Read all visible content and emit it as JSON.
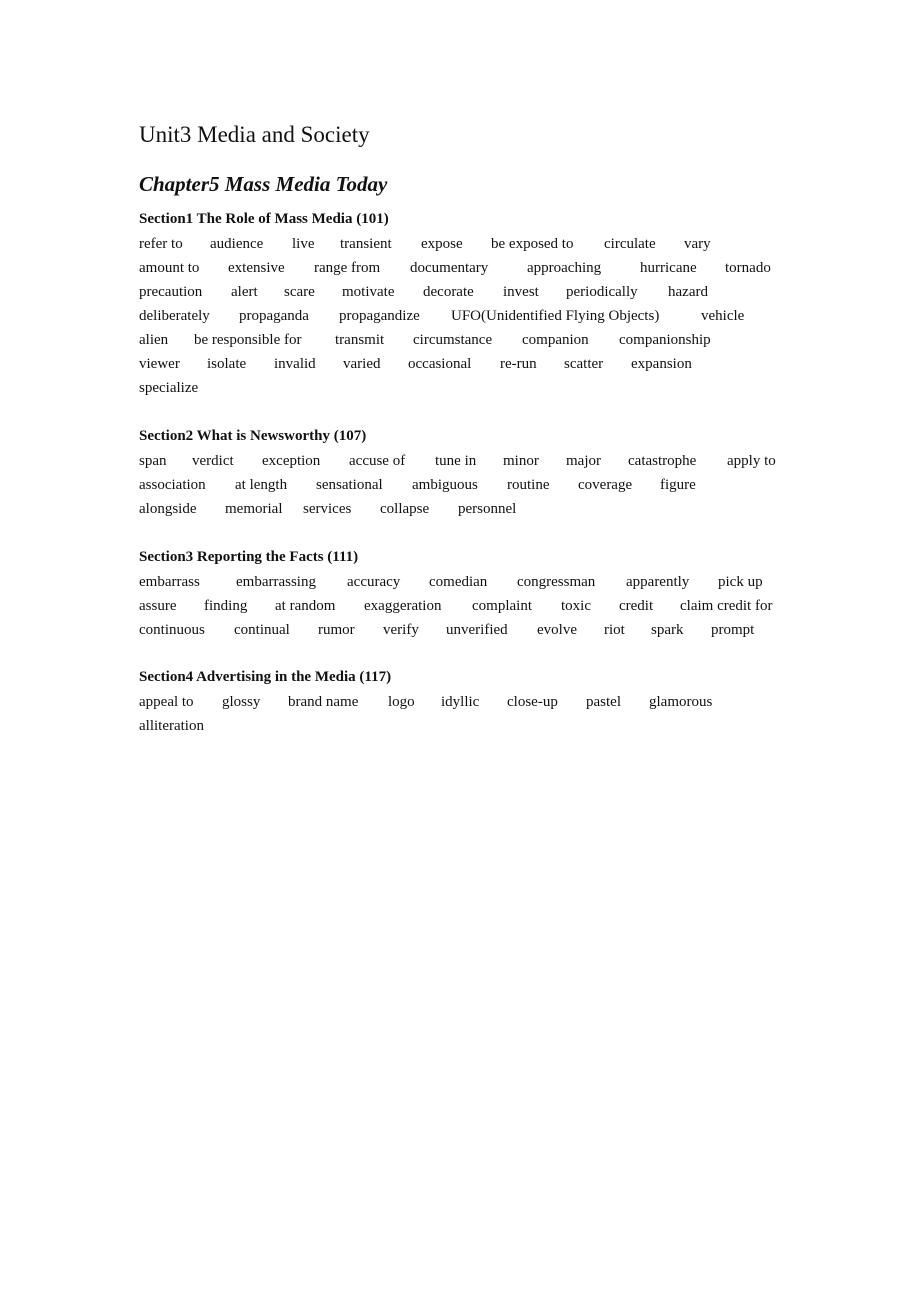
{
  "document": {
    "unit_title": "Unit3 Media and Society",
    "chapter_title": "Chapter5 Mass Media Today",
    "sections": [
      {
        "title": "Section1 The Role of Mass Media (101)",
        "lines": [
          [
            "refer to",
            "audience",
            "live",
            "transient",
            "expose",
            "be exposed to",
            "circulate",
            "vary"
          ],
          [
            "amount to",
            "extensive",
            "range from",
            "documentary",
            "approaching",
            "hurricane",
            "tornado"
          ],
          [
            "precaution",
            "alert",
            "scare",
            "motivate",
            "decorate",
            "invest",
            "periodically",
            "hazard"
          ],
          [
            "deliberately",
            "propaganda",
            "propagandize",
            "UFO(Unidentified Flying Objects)",
            "vehicle"
          ],
          [
            "alien",
            "be responsible for",
            "transmit",
            "circumstance",
            "companion",
            "companionship"
          ],
          [
            "viewer",
            "isolate",
            "invalid",
            "varied",
            "occasional",
            "re-run",
            "scatter",
            "expansion"
          ],
          [
            "specialize"
          ]
        ]
      },
      {
        "title": "Section2 What is Newsworthy (107)",
        "lines": [
          [
            "span",
            "verdict",
            "exception",
            "accuse of",
            "tune in",
            "minor",
            "major",
            "catastrophe",
            "apply to"
          ],
          [
            "association",
            "at length",
            "sensational",
            "ambiguous",
            "routine",
            "coverage",
            "figure"
          ],
          [
            "alongside",
            "memorial",
            "services",
            "collapse",
            "personnel"
          ]
        ]
      },
      {
        "title": "Section3 Reporting the Facts (111)",
        "lines": [
          [
            "embarrass",
            "embarrassing",
            "accuracy",
            "comedian",
            "congressman",
            "apparently",
            "pick up"
          ],
          [
            "assure",
            "finding",
            "at random",
            "exaggeration",
            "complaint",
            "toxic",
            "credit",
            "claim credit for"
          ],
          [
            "continuous",
            "continual",
            "rumor",
            "verify",
            "unverified",
            "evolve",
            "riot",
            "spark",
            "prompt"
          ]
        ]
      },
      {
        "title": "Section4 Advertising in the Media (117)",
        "lines": [
          [
            "appeal to",
            "glossy",
            "brand name",
            "logo",
            "idyllic",
            "close-up",
            "pastel",
            "glamorous"
          ],
          [
            "alliteration"
          ]
        ]
      }
    ]
  }
}
